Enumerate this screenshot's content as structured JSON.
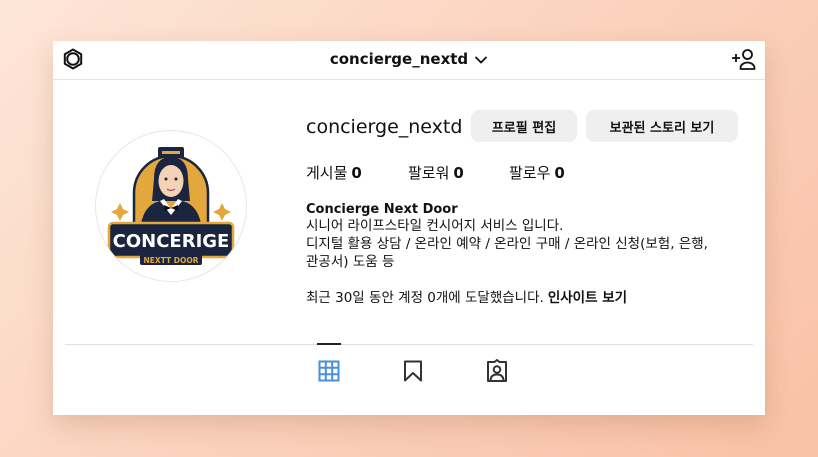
{
  "header": {
    "username": "concierge_nextd",
    "icons": {
      "left": "settings-icon",
      "dropdown": "chevron-down-icon",
      "right": "add-user-icon"
    }
  },
  "profile": {
    "avatar": {
      "logo_main": "CONCERIGE",
      "logo_sub": "NEXTT DOOR"
    },
    "username": "concierge_nextd",
    "buttons": {
      "edit": "프로필 편집",
      "archive": "보관된 스토리 보기"
    },
    "stats": [
      {
        "label": "게시물",
        "value": "0"
      },
      {
        "label": "팔로워",
        "value": "0"
      },
      {
        "label": "팔로우",
        "value": "0"
      }
    ],
    "bio": {
      "name": "Concierge Next Door",
      "text": "시니어 라이프스타일 컨시어지 서비스 입니다.\n디지털 활용 상담 / 온라인 예약 / 온라인 구매 / 온라인 신청(보험, 은행,\n관공서) 도움 등"
    },
    "insight": {
      "text": "최근 30일 동안 계정 0개에 도달했습니다.",
      "link": "인사이트 보기"
    }
  },
  "tabs": [
    {
      "name": "posts",
      "icon": "grid-icon",
      "active": true
    },
    {
      "name": "saved",
      "icon": "bookmark-icon",
      "active": false
    },
    {
      "name": "tagged",
      "icon": "tagged-person-icon",
      "active": false
    }
  ],
  "colors": {
    "accent": "#4a90d9",
    "background": "#fbd2bd",
    "button": "#efefef",
    "gold": "#e3a73b",
    "navy": "#1b2540"
  }
}
